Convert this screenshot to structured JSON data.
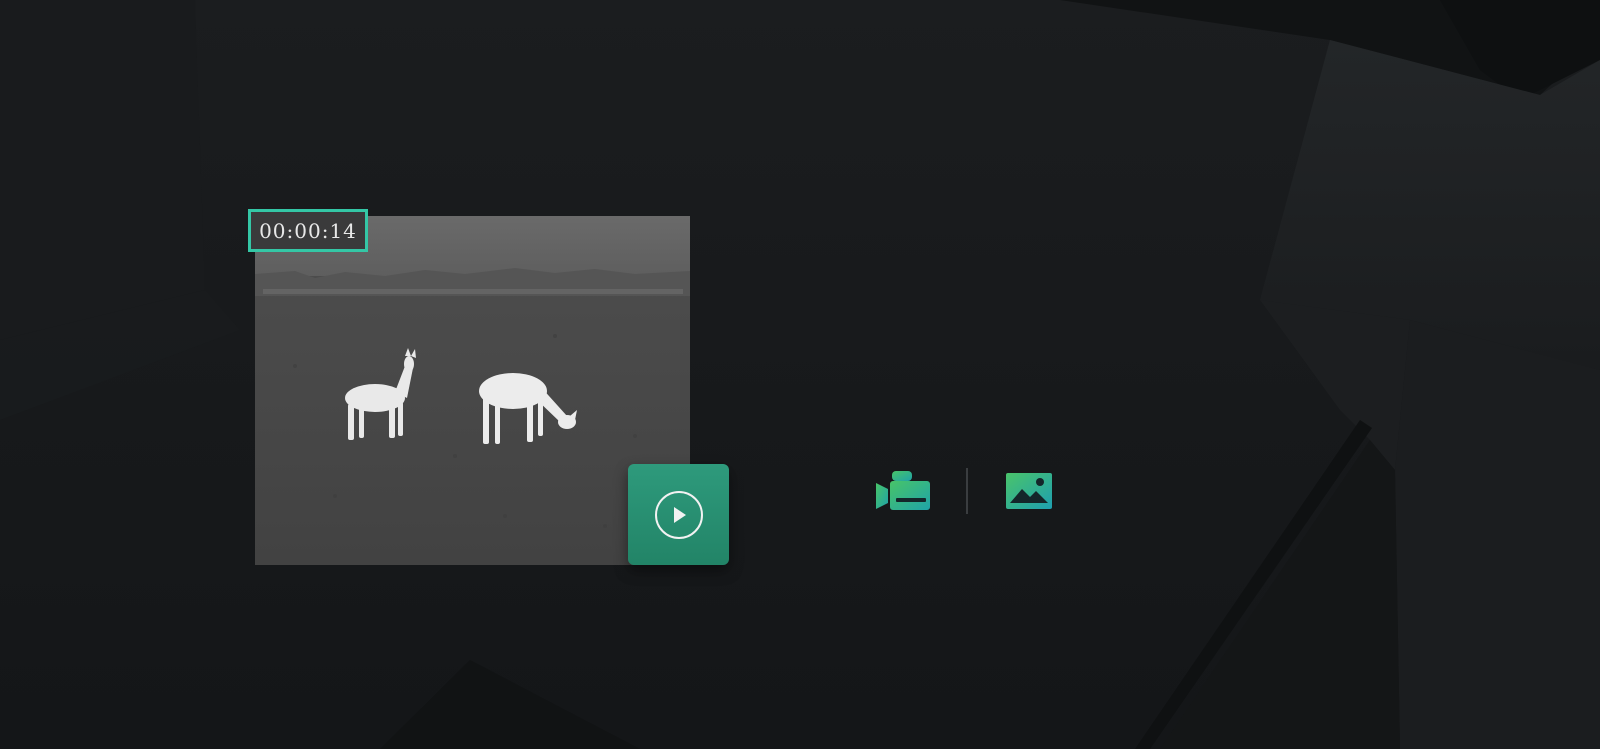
{
  "player": {
    "timecode": "00:00:14",
    "play_icon": "play-icon"
  },
  "media_switch": {
    "video_icon": "video-camera-icon",
    "image_icon": "image-icon"
  },
  "colors": {
    "accent": "#34c7a6",
    "button": "#2a9070",
    "background": "#17191b"
  }
}
